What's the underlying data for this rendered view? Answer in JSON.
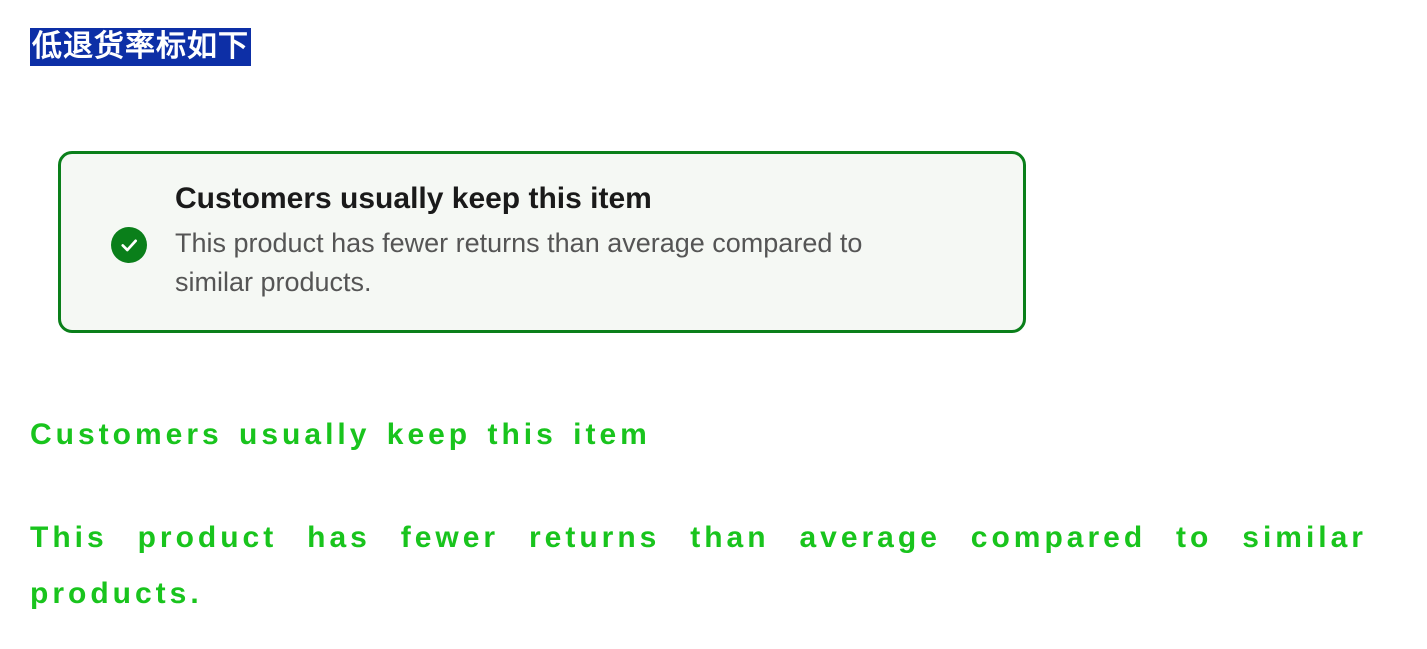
{
  "heading": "低退货率标如下",
  "callout": {
    "title": "Customers usually keep this item",
    "description": "This product has fewer returns than average compared to similar products."
  },
  "highlight": {
    "title": "Customers usually keep this item",
    "description": "This product has fewer returns than average compared to similar products."
  }
}
